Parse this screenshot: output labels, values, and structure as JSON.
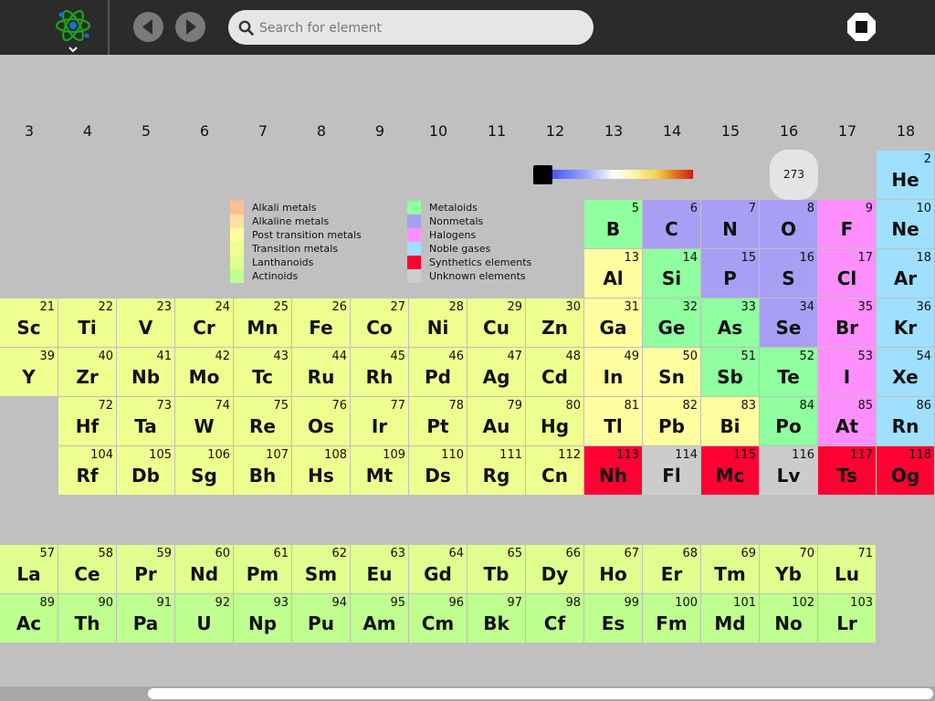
{
  "toolbar": {
    "logo_icon": "atom-icon",
    "back_icon": "back-arrow-icon",
    "forward_icon": "forward-arrow-icon",
    "search_placeholder": "Search for element",
    "stop_icon": "stop-icon"
  },
  "groups": [
    "3",
    "4",
    "5",
    "6",
    "7",
    "8",
    "9",
    "10",
    "11",
    "12",
    "13",
    "14",
    "15",
    "16",
    "17",
    "18"
  ],
  "colors": {
    "alkali": "#ffbf8f",
    "alkaline": "#ffdf9f",
    "post": "#ffff9f",
    "transition": "#efff8f",
    "lanth": "#dfff8f",
    "actin": "#bfff8f",
    "metalloid": "#8fff9f",
    "nonmetal": "#a89ff5",
    "halogen": "#ff8fff",
    "noble": "#9fdfff",
    "synth": "#ff0033",
    "unknown": "#cccccc"
  },
  "legend_left": [
    {
      "label": "Alkali metals",
      "cat": "alkali"
    },
    {
      "label": "Alkaline metals",
      "cat": "alkaline"
    },
    {
      "label": "Post transition metals",
      "cat": "post"
    },
    {
      "label": "Transition metals",
      "cat": "transition"
    },
    {
      "label": "Lanthanoids",
      "cat": "lanth"
    },
    {
      "label": "Actinoids",
      "cat": "actin"
    }
  ],
  "legend_right": [
    {
      "label": "Metaloids",
      "cat": "metalloid"
    },
    {
      "label": "Nonmetals",
      "cat": "nonmetal"
    },
    {
      "label": "Halogens",
      "cat": "halogen"
    },
    {
      "label": "Noble gases",
      "cat": "noble"
    },
    {
      "label": "Synthetics elements",
      "cat": "synth"
    },
    {
      "label": "Unknown elements",
      "cat": "unknown"
    }
  ],
  "temperature": {
    "value": "273",
    "level": 0
  },
  "elements": [
    {
      "n": "2",
      "s": "He",
      "row": 1,
      "col": 18,
      "cat": "noble"
    },
    {
      "n": "5",
      "s": "B",
      "row": 2,
      "col": 13,
      "cat": "metalloid"
    },
    {
      "n": "6",
      "s": "C",
      "row": 2,
      "col": 14,
      "cat": "nonmetal"
    },
    {
      "n": "7",
      "s": "N",
      "row": 2,
      "col": 15,
      "cat": "nonmetal"
    },
    {
      "n": "8",
      "s": "O",
      "row": 2,
      "col": 16,
      "cat": "nonmetal"
    },
    {
      "n": "9",
      "s": "F",
      "row": 2,
      "col": 17,
      "cat": "halogen"
    },
    {
      "n": "10",
      "s": "Ne",
      "row": 2,
      "col": 18,
      "cat": "noble"
    },
    {
      "n": "13",
      "s": "Al",
      "row": 3,
      "col": 13,
      "cat": "post"
    },
    {
      "n": "14",
      "s": "Si",
      "row": 3,
      "col": 14,
      "cat": "metalloid"
    },
    {
      "n": "15",
      "s": "P",
      "row": 3,
      "col": 15,
      "cat": "nonmetal"
    },
    {
      "n": "16",
      "s": "S",
      "row": 3,
      "col": 16,
      "cat": "nonmetal"
    },
    {
      "n": "17",
      "s": "Cl",
      "row": 3,
      "col": 17,
      "cat": "halogen"
    },
    {
      "n": "18",
      "s": "Ar",
      "row": 3,
      "col": 18,
      "cat": "noble"
    },
    {
      "n": "21",
      "s": "Sc",
      "row": 4,
      "col": 3,
      "cat": "transition"
    },
    {
      "n": "22",
      "s": "Ti",
      "row": 4,
      "col": 4,
      "cat": "transition"
    },
    {
      "n": "23",
      "s": "V",
      "row": 4,
      "col": 5,
      "cat": "transition"
    },
    {
      "n": "24",
      "s": "Cr",
      "row": 4,
      "col": 6,
      "cat": "transition"
    },
    {
      "n": "25",
      "s": "Mn",
      "row": 4,
      "col": 7,
      "cat": "transition"
    },
    {
      "n": "26",
      "s": "Fe",
      "row": 4,
      "col": 8,
      "cat": "transition"
    },
    {
      "n": "27",
      "s": "Co",
      "row": 4,
      "col": 9,
      "cat": "transition"
    },
    {
      "n": "28",
      "s": "Ni",
      "row": 4,
      "col": 10,
      "cat": "transition"
    },
    {
      "n": "29",
      "s": "Cu",
      "row": 4,
      "col": 11,
      "cat": "transition"
    },
    {
      "n": "30",
      "s": "Zn",
      "row": 4,
      "col": 12,
      "cat": "transition"
    },
    {
      "n": "31",
      "s": "Ga",
      "row": 4,
      "col": 13,
      "cat": "post"
    },
    {
      "n": "32",
      "s": "Ge",
      "row": 4,
      "col": 14,
      "cat": "metalloid"
    },
    {
      "n": "33",
      "s": "As",
      "row": 4,
      "col": 15,
      "cat": "metalloid"
    },
    {
      "n": "34",
      "s": "Se",
      "row": 4,
      "col": 16,
      "cat": "nonmetal"
    },
    {
      "n": "35",
      "s": "Br",
      "row": 4,
      "col": 17,
      "cat": "halogen"
    },
    {
      "n": "36",
      "s": "Kr",
      "row": 4,
      "col": 18,
      "cat": "noble"
    },
    {
      "n": "39",
      "s": "Y",
      "row": 5,
      "col": 3,
      "cat": "transition"
    },
    {
      "n": "40",
      "s": "Zr",
      "row": 5,
      "col": 4,
      "cat": "transition"
    },
    {
      "n": "41",
      "s": "Nb",
      "row": 5,
      "col": 5,
      "cat": "transition"
    },
    {
      "n": "42",
      "s": "Mo",
      "row": 5,
      "col": 6,
      "cat": "transition"
    },
    {
      "n": "43",
      "s": "Tc",
      "row": 5,
      "col": 7,
      "cat": "transition"
    },
    {
      "n": "44",
      "s": "Ru",
      "row": 5,
      "col": 8,
      "cat": "transition"
    },
    {
      "n": "45",
      "s": "Rh",
      "row": 5,
      "col": 9,
      "cat": "transition"
    },
    {
      "n": "46",
      "s": "Pd",
      "row": 5,
      "col": 10,
      "cat": "transition"
    },
    {
      "n": "47",
      "s": "Ag",
      "row": 5,
      "col": 11,
      "cat": "transition"
    },
    {
      "n": "48",
      "s": "Cd",
      "row": 5,
      "col": 12,
      "cat": "transition"
    },
    {
      "n": "49",
      "s": "In",
      "row": 5,
      "col": 13,
      "cat": "post"
    },
    {
      "n": "50",
      "s": "Sn",
      "row": 5,
      "col": 14,
      "cat": "post"
    },
    {
      "n": "51",
      "s": "Sb",
      "row": 5,
      "col": 15,
      "cat": "metalloid"
    },
    {
      "n": "52",
      "s": "Te",
      "row": 5,
      "col": 16,
      "cat": "metalloid"
    },
    {
      "n": "53",
      "s": "I",
      "row": 5,
      "col": 17,
      "cat": "halogen"
    },
    {
      "n": "54",
      "s": "Xe",
      "row": 5,
      "col": 18,
      "cat": "noble"
    },
    {
      "n": "72",
      "s": "Hf",
      "row": 6,
      "col": 4,
      "cat": "transition"
    },
    {
      "n": "73",
      "s": "Ta",
      "row": 6,
      "col": 5,
      "cat": "transition"
    },
    {
      "n": "74",
      "s": "W",
      "row": 6,
      "col": 6,
      "cat": "transition"
    },
    {
      "n": "75",
      "s": "Re",
      "row": 6,
      "col": 7,
      "cat": "transition"
    },
    {
      "n": "76",
      "s": "Os",
      "row": 6,
      "col": 8,
      "cat": "transition"
    },
    {
      "n": "77",
      "s": "Ir",
      "row": 6,
      "col": 9,
      "cat": "transition"
    },
    {
      "n": "78",
      "s": "Pt",
      "row": 6,
      "col": 10,
      "cat": "transition"
    },
    {
      "n": "79",
      "s": "Au",
      "row": 6,
      "col": 11,
      "cat": "transition"
    },
    {
      "n": "80",
      "s": "Hg",
      "row": 6,
      "col": 12,
      "cat": "transition"
    },
    {
      "n": "81",
      "s": "Tl",
      "row": 6,
      "col": 13,
      "cat": "post"
    },
    {
      "n": "82",
      "s": "Pb",
      "row": 6,
      "col": 14,
      "cat": "post"
    },
    {
      "n": "83",
      "s": "Bi",
      "row": 6,
      "col": 15,
      "cat": "post"
    },
    {
      "n": "84",
      "s": "Po",
      "row": 6,
      "col": 16,
      "cat": "metalloid"
    },
    {
      "n": "85",
      "s": "At",
      "row": 6,
      "col": 17,
      "cat": "halogen"
    },
    {
      "n": "86",
      "s": "Rn",
      "row": 6,
      "col": 18,
      "cat": "noble"
    },
    {
      "n": "104",
      "s": "Rf",
      "row": 7,
      "col": 4,
      "cat": "transition"
    },
    {
      "n": "105",
      "s": "Db",
      "row": 7,
      "col": 5,
      "cat": "transition"
    },
    {
      "n": "106",
      "s": "Sg",
      "row": 7,
      "col": 6,
      "cat": "transition"
    },
    {
      "n": "107",
      "s": "Bh",
      "row": 7,
      "col": 7,
      "cat": "transition"
    },
    {
      "n": "108",
      "s": "Hs",
      "row": 7,
      "col": 8,
      "cat": "transition"
    },
    {
      "n": "109",
      "s": "Mt",
      "row": 7,
      "col": 9,
      "cat": "transition"
    },
    {
      "n": "110",
      "s": "Ds",
      "row": 7,
      "col": 10,
      "cat": "transition"
    },
    {
      "n": "111",
      "s": "Rg",
      "row": 7,
      "col": 11,
      "cat": "transition"
    },
    {
      "n": "112",
      "s": "Cn",
      "row": 7,
      "col": 12,
      "cat": "transition"
    },
    {
      "n": "113",
      "s": "Nh",
      "row": 7,
      "col": 13,
      "cat": "synth"
    },
    {
      "n": "114",
      "s": "Fl",
      "row": 7,
      "col": 14,
      "cat": "unknown"
    },
    {
      "n": "115",
      "s": "Mc",
      "row": 7,
      "col": 15,
      "cat": "synth"
    },
    {
      "n": "116",
      "s": "Lv",
      "row": 7,
      "col": 16,
      "cat": "unknown"
    },
    {
      "n": "117",
      "s": "Ts",
      "row": 7,
      "col": 17,
      "cat": "synth"
    },
    {
      "n": "118",
      "s": "Og",
      "row": 7,
      "col": 18,
      "cat": "synth"
    },
    {
      "n": "57",
      "s": "La",
      "row": 9,
      "col": 3,
      "cat": "lanth"
    },
    {
      "n": "58",
      "s": "Ce",
      "row": 9,
      "col": 4,
      "cat": "lanth"
    },
    {
      "n": "59",
      "s": "Pr",
      "row": 9,
      "col": 5,
      "cat": "lanth"
    },
    {
      "n": "60",
      "s": "Nd",
      "row": 9,
      "col": 6,
      "cat": "lanth"
    },
    {
      "n": "61",
      "s": "Pm",
      "row": 9,
      "col": 7,
      "cat": "lanth"
    },
    {
      "n": "62",
      "s": "Sm",
      "row": 9,
      "col": 8,
      "cat": "lanth"
    },
    {
      "n": "63",
      "s": "Eu",
      "row": 9,
      "col": 9,
      "cat": "lanth"
    },
    {
      "n": "64",
      "s": "Gd",
      "row": 9,
      "col": 10,
      "cat": "lanth"
    },
    {
      "n": "65",
      "s": "Tb",
      "row": 9,
      "col": 11,
      "cat": "lanth"
    },
    {
      "n": "66",
      "s": "Dy",
      "row": 9,
      "col": 12,
      "cat": "lanth"
    },
    {
      "n": "67",
      "s": "Ho",
      "row": 9,
      "col": 13,
      "cat": "lanth"
    },
    {
      "n": "68",
      "s": "Er",
      "row": 9,
      "col": 14,
      "cat": "lanth"
    },
    {
      "n": "69",
      "s": "Tm",
      "row": 9,
      "col": 15,
      "cat": "lanth"
    },
    {
      "n": "70",
      "s": "Yb",
      "row": 9,
      "col": 16,
      "cat": "lanth"
    },
    {
      "n": "71",
      "s": "Lu",
      "row": 9,
      "col": 17,
      "cat": "lanth"
    },
    {
      "n": "89",
      "s": "Ac",
      "row": 10,
      "col": 3,
      "cat": "actin"
    },
    {
      "n": "90",
      "s": "Th",
      "row": 10,
      "col": 4,
      "cat": "actin"
    },
    {
      "n": "91",
      "s": "Pa",
      "row": 10,
      "col": 5,
      "cat": "actin"
    },
    {
      "n": "92",
      "s": "U",
      "row": 10,
      "col": 6,
      "cat": "actin"
    },
    {
      "n": "93",
      "s": "Np",
      "row": 10,
      "col": 7,
      "cat": "actin"
    },
    {
      "n": "94",
      "s": "Pu",
      "row": 10,
      "col": 8,
      "cat": "actin"
    },
    {
      "n": "95",
      "s": "Am",
      "row": 10,
      "col": 9,
      "cat": "actin"
    },
    {
      "n": "96",
      "s": "Cm",
      "row": 10,
      "col": 10,
      "cat": "actin"
    },
    {
      "n": "97",
      "s": "Bk",
      "row": 10,
      "col": 11,
      "cat": "actin"
    },
    {
      "n": "98",
      "s": "Cf",
      "row": 10,
      "col": 12,
      "cat": "actin"
    },
    {
      "n": "99",
      "s": "Es",
      "row": 10,
      "col": 13,
      "cat": "actin"
    },
    {
      "n": "100",
      "s": "Fm",
      "row": 10,
      "col": 14,
      "cat": "actin"
    },
    {
      "n": "101",
      "s": "Md",
      "row": 10,
      "col": 15,
      "cat": "actin"
    },
    {
      "n": "102",
      "s": "No",
      "row": 10,
      "col": 16,
      "cat": "actin"
    },
    {
      "n": "103",
      "s": "Lr",
      "row": 10,
      "col": 17,
      "cat": "actin"
    }
  ]
}
